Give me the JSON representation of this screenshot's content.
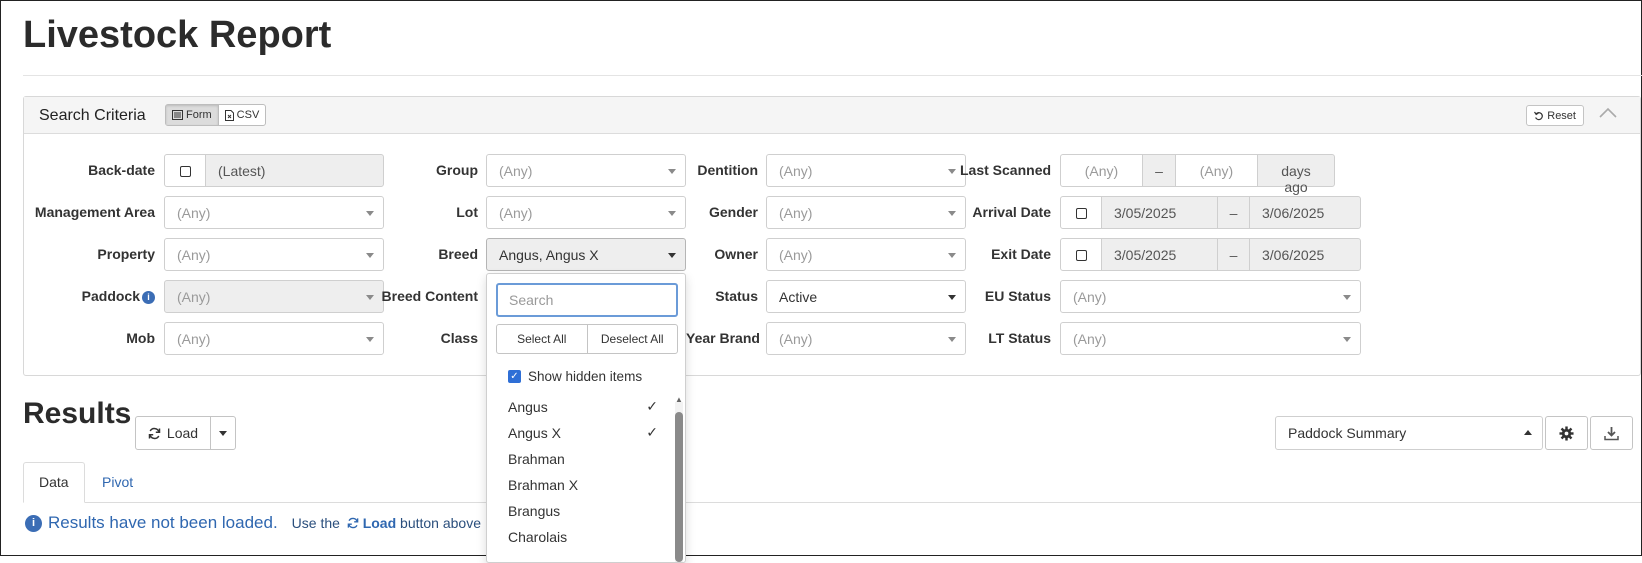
{
  "page": {
    "title": "Livestock Report"
  },
  "criteria": {
    "title": "Search Criteria",
    "mode_form": "Form",
    "mode_csv": "CSV",
    "reset": "Reset",
    "fields": {
      "backdate": {
        "label": "Back-date",
        "value": "(Latest)"
      },
      "management_area": {
        "label": "Management Area",
        "value": "(Any)"
      },
      "property": {
        "label": "Property",
        "value": "(Any)"
      },
      "paddock": {
        "label": "Paddock",
        "value": "(Any)"
      },
      "mob": {
        "label": "Mob",
        "value": "(Any)"
      },
      "group": {
        "label": "Group",
        "value": "(Any)"
      },
      "lot": {
        "label": "Lot",
        "value": "(Any)"
      },
      "breed": {
        "label": "Breed",
        "value": "Angus, Angus X"
      },
      "breed_content": {
        "label": "Breed Content"
      },
      "class": {
        "label": "Class"
      },
      "dentition": {
        "label": "Dentition",
        "value": "(Any)"
      },
      "gender": {
        "label": "Gender",
        "value": "(Any)"
      },
      "owner": {
        "label": "Owner",
        "value": "(Any)"
      },
      "status": {
        "label": "Status",
        "value": "Active"
      },
      "year_brand": {
        "label": "Year Brand",
        "value": "(Any)"
      },
      "last_scanned": {
        "label": "Last Scanned",
        "from": "(Any)",
        "sep": "–",
        "to": "(Any)",
        "suffix": "days ago"
      },
      "arrival_date": {
        "label": "Arrival Date",
        "from": "3/05/2025",
        "sep": "–",
        "to": "3/06/2025"
      },
      "exit_date": {
        "label": "Exit Date",
        "from": "3/05/2025",
        "sep": "–",
        "to": "3/06/2025"
      },
      "eu_status": {
        "label": "EU Status",
        "value": "(Any)"
      },
      "lt_status": {
        "label": "LT Status",
        "value": "(Any)"
      }
    }
  },
  "breed_dropdown": {
    "search_placeholder": "Search",
    "select_all": "Select All",
    "deselect_all": "Deselect All",
    "show_hidden": "Show hidden items",
    "options": [
      {
        "label": "Angus",
        "checked": true
      },
      {
        "label": "Angus X",
        "checked": true
      },
      {
        "label": "Brahman",
        "checked": false
      },
      {
        "label": "Brahman X",
        "checked": false
      },
      {
        "label": "Brangus",
        "checked": false
      },
      {
        "label": "Charolais",
        "checked": false
      }
    ]
  },
  "results": {
    "title": "Results",
    "load_label": "Load",
    "summary_select": "Paddock Summary",
    "tabs": [
      "Data",
      "Pivot"
    ],
    "message": "Results have not been loaded.",
    "hint_prefix": "Use the",
    "hint_load": "Load",
    "hint_suffix": "button above"
  }
}
